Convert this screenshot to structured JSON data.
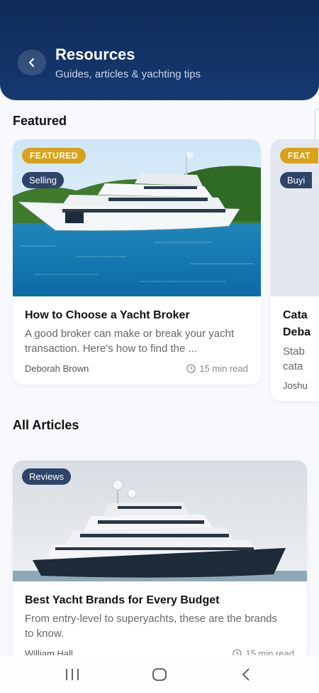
{
  "header": {
    "title": "Resources",
    "subtitle": "Guides, articles & yachting tips"
  },
  "featured": {
    "section_title": "Featured",
    "cards": [
      {
        "badge": "FEATURED",
        "category": "Selling",
        "title": "How to Choose a Yacht Broker",
        "description": "A good broker can make or break your yacht transaction. Here's how to find the ...",
        "author": "Deborah Brown",
        "read_time": "15 min read"
      },
      {
        "badge": "FEAT",
        "category": "Buyi",
        "title_line1": "Cata",
        "title_line2": "Deba",
        "desc_line1": "Stab",
        "desc_line2": "cata",
        "author": "Joshu"
      }
    ]
  },
  "all_articles": {
    "section_title": "All Articles",
    "cards": [
      {
        "category": "Reviews",
        "title": "Best Yacht Brands for Every Budget",
        "description": "From entry-level to superyachts, these are the brands to know.",
        "author": "William Hall",
        "read_time": "15 min read"
      }
    ]
  },
  "colors": {
    "header": "#163a73",
    "badge_featured": "#d9a21b",
    "badge_category": "#2f4468"
  },
  "navbar": {
    "icons": [
      "recent-apps-icon",
      "home-icon",
      "back-icon"
    ]
  }
}
